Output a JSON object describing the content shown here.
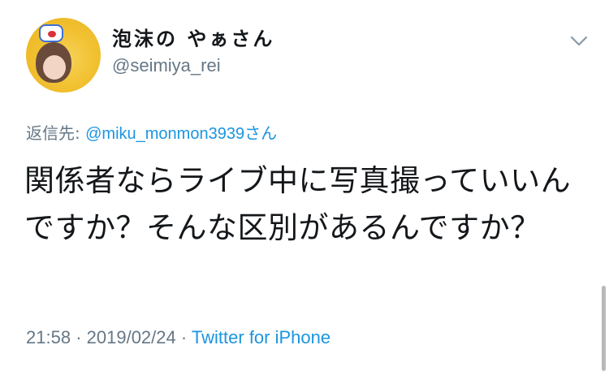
{
  "user": {
    "display_name": "泡沫の やぁさん",
    "handle": "@seimiya_rei"
  },
  "reply": {
    "prefix": "返信先:",
    "mention": "@miku_monmon3939",
    "suffix": "さん"
  },
  "tweet": {
    "text": "関係者ならライブ中に写真撮っていいんですか？そんな区別があるんですか？"
  },
  "meta": {
    "time": "21:58",
    "separator1": "·",
    "date": "2019/02/24",
    "separator2": "·",
    "source": "Twitter for iPhone"
  },
  "icons": {
    "menu": "chevron-down-icon",
    "avatar": "profile-avatar"
  },
  "colors": {
    "text_primary": "#14171a",
    "text_secondary": "#657786",
    "link": "#1b95e0"
  }
}
